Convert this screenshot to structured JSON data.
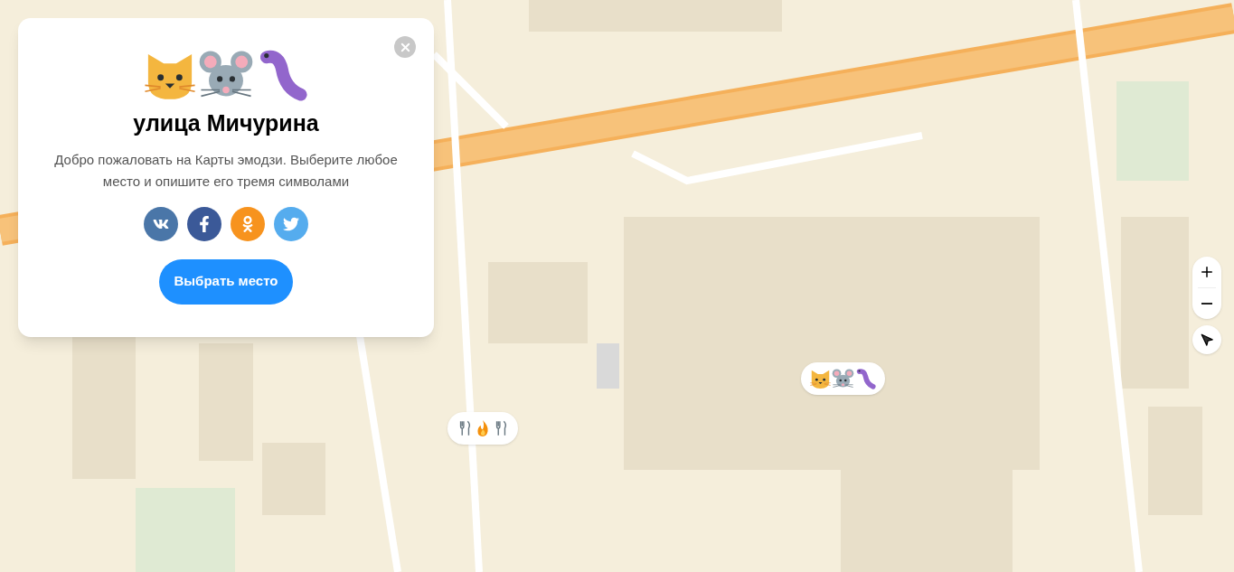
{
  "popup": {
    "symbols": [
      {
        "kind": "cat"
      },
      {
        "kind": "mouse"
      },
      {
        "kind": "caterpillar"
      }
    ],
    "title": "улица Мичурина",
    "description": "Добро пожаловать на Карты эмодзи. Выберите любое место и опишите его тремя символами",
    "share_buttons": [
      {
        "kind": "vk"
      },
      {
        "kind": "facebook"
      },
      {
        "kind": "odnoklassniki"
      },
      {
        "kind": "twitter"
      }
    ],
    "action_button": "Выбрать место"
  },
  "map": {
    "markers": [
      {
        "kind": "place",
        "symbols": [
          {
            "kind": "cat"
          },
          {
            "kind": "mouse"
          },
          {
            "kind": "caterpillar"
          }
        ]
      },
      {
        "kind": "food",
        "symbols": [
          {
            "kind": "fork"
          },
          {
            "kind": "fire"
          },
          {
            "kind": "fork"
          }
        ]
      }
    ]
  }
}
